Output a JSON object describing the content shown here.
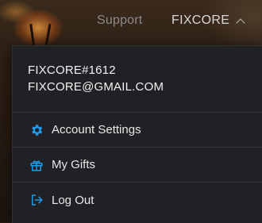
{
  "nav": {
    "support_label": "Support",
    "account_label": "FIXCORE",
    "account_chevron_icon": "chevron-up-icon"
  },
  "dropdown": {
    "username": "FIXCORE#1612",
    "email": "FIXCORE@GMAIL.COM",
    "items": [
      {
        "label": "Account Settings",
        "icon": "gear-icon"
      },
      {
        "label": "My Gifts",
        "icon": "gift-icon"
      },
      {
        "label": "Log Out",
        "icon": "logout-icon"
      }
    ]
  },
  "colors": {
    "accent": "#1e9bea",
    "panel_bg": "#202124",
    "text": "#e8e8e8",
    "nav_muted": "#8c8a88"
  }
}
